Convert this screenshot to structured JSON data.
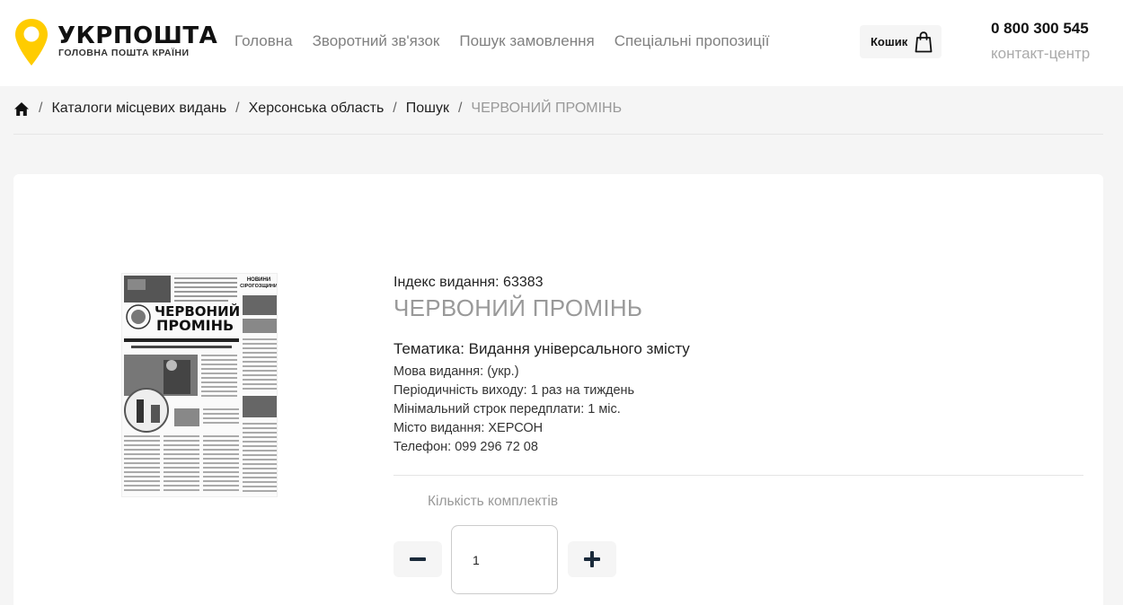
{
  "header": {
    "logo": {
      "name": "УКРПОШТА",
      "tagline": "ГОЛОВНА ПОШТА КРАЇНИ",
      "color": "#FFCC00"
    },
    "nav": [
      "Головна",
      "Зворотний зв'язок",
      "Пошук замовлення",
      "Спеціальні пропозиції"
    ],
    "cart_label": "Кошик",
    "phone": "0 800 300 545",
    "phone_label": "контакт-центр"
  },
  "breadcrumb": {
    "home_icon": "home-icon",
    "items": [
      "Каталоги місцевих видань",
      "Херсонська область",
      "Пошук"
    ],
    "current": "ЧЕРВОНИЙ ПРОМІНЬ",
    "separator": "/"
  },
  "product": {
    "index": "Індекс видання: 63383",
    "title": "ЧЕРВОНИЙ ПРОМІНЬ",
    "theme": "Тематика: Видання універсального змісту",
    "details": [
      "Мова видання: (укр.)",
      "Періодичність виходу: 1 раз на тиждень",
      "Мінімальний строк передплати: 1 міс.",
      "Місто видання: ХЕРСОН",
      "Телефон: 099 296 72 08"
    ],
    "cover": {
      "masthead_line1": "ЧЕРВОНИЙ",
      "masthead_line2": "ПРОМІНЬ",
      "side_heading_1": "НОВИНИ",
      "side_heading_2": "СІРОГОЗЩИНИ"
    }
  },
  "quantity": {
    "label": "Кількість комплектів",
    "value": "1",
    "minus_icon": "minus-icon",
    "plus_icon": "plus-icon"
  }
}
